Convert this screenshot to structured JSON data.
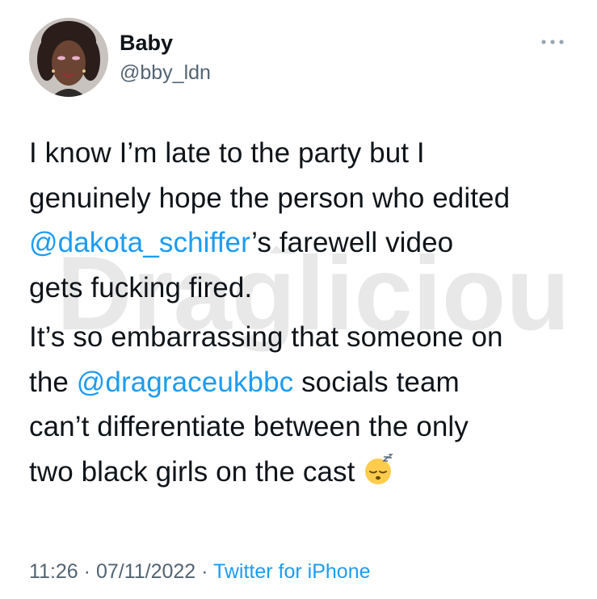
{
  "author": {
    "display_name": "Baby",
    "handle": "@bby_ldn"
  },
  "more_icon": "more-horizontal-icon",
  "tweet": {
    "paragraph_1": {
      "line_1": "I know I’m late to the party but I",
      "line_2": "genuinely hope the person who edited",
      "mention": "@dakota_schiffer",
      "line_3_rest": "’s farewell video",
      "line_4": "gets fucking fired."
    },
    "paragraph_2": {
      "line_1": "It’s so embarrassing that someone on",
      "prefix": "the ",
      "mention": "@dragraceukbbc",
      "line_2_rest": " socials team",
      "line_3": "can’t differentiate between the only",
      "line_4": "two black girls on the cast"
    },
    "emoji": "sleeping-face-emoji"
  },
  "watermark": {
    "text": "Draglicious"
  },
  "meta": {
    "time": "11:26",
    "date": "07/11/2022",
    "separator": " · ",
    "source": "Twitter for iPhone"
  },
  "colors": {
    "text": "#0f1419",
    "secondary": "#536471",
    "link": "#1d9bf0",
    "background": "#ffffff"
  }
}
